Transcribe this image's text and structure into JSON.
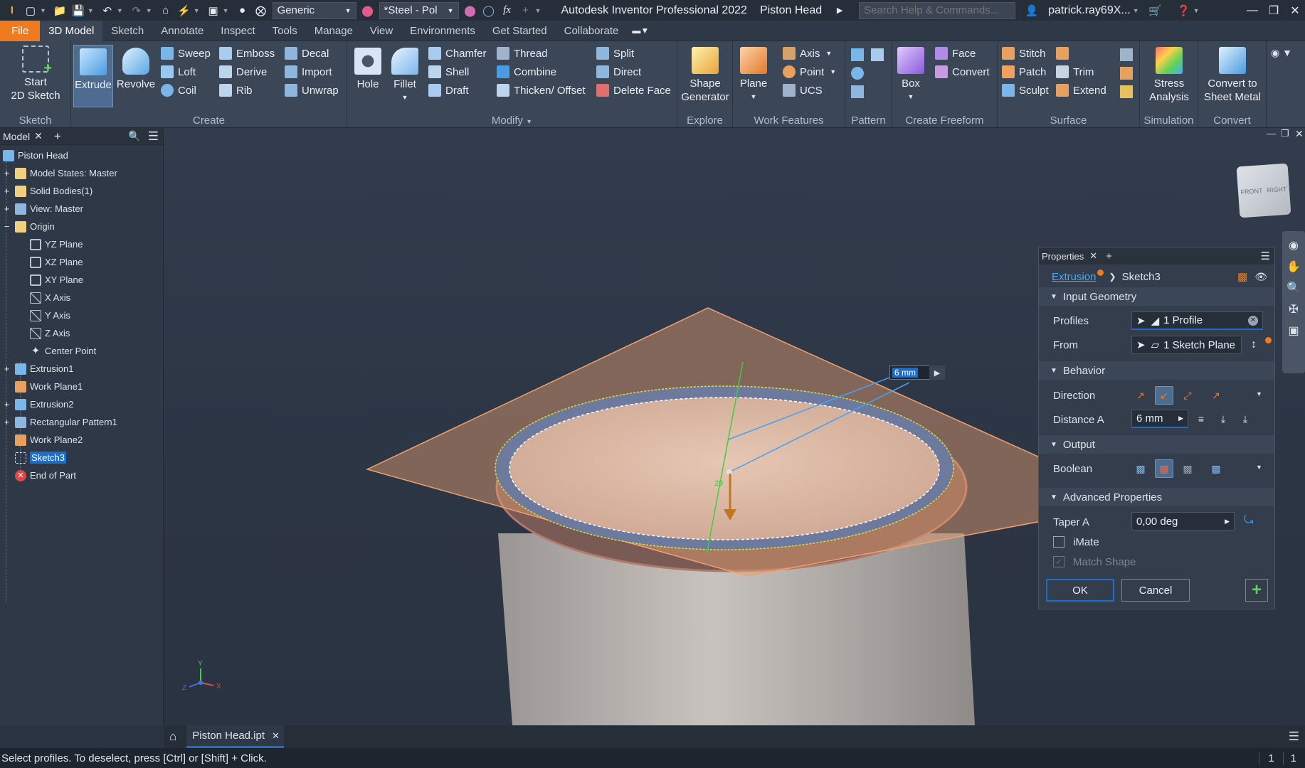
{
  "titlebar": {
    "appearance": "Generic",
    "material": "*Steel - Pol",
    "app_title": "Autodesk Inventor Professional 2022",
    "doc_name": "Piston Head",
    "search_placeholder": "Search Help & Commands...",
    "user": "patrick.ray69X..."
  },
  "menu": {
    "tabs": [
      "File",
      "3D Model",
      "Sketch",
      "Annotate",
      "Inspect",
      "Tools",
      "Manage",
      "View",
      "Environments",
      "Get Started",
      "Collaborate"
    ]
  },
  "ribbon": {
    "sketch": {
      "label": "Sketch",
      "start": "Start",
      "start2": "2D Sketch"
    },
    "create": {
      "label": "Create",
      "extrude": "Extrude",
      "revolve": "Revolve",
      "sweep": "Sweep",
      "emboss": "Emboss",
      "decal": "Decal",
      "loft": "Loft",
      "derive": "Derive",
      "import": "Import",
      "coil": "Coil",
      "rib": "Rib",
      "unwrap": "Unwrap"
    },
    "modify": {
      "label": "Modify",
      "hole": "Hole",
      "fillet": "Fillet",
      "chamfer": "Chamfer",
      "thread": "Thread",
      "split": "Split",
      "shell": "Shell",
      "combine": "Combine",
      "direct": "Direct",
      "draft": "Draft",
      "thicken": "Thicken/ Offset",
      "delete_face": "Delete Face"
    },
    "explore": {
      "label": "Explore",
      "shape": "Shape",
      "generator": "Generator"
    },
    "work": {
      "label": "Work Features",
      "plane": "Plane",
      "axis": "Axis",
      "point": "Point",
      "ucs": "UCS"
    },
    "pattern": {
      "label": "Pattern"
    },
    "freeform": {
      "label": "Create Freeform",
      "box": "Box",
      "face": "Face",
      "convert": "Convert"
    },
    "surface": {
      "label": "Surface",
      "stitch": "Stitch",
      "patch": "Patch",
      "trim": "Trim",
      "sculpt": "Sculpt",
      "extend": "Extend"
    },
    "simulation": {
      "label": "Simulation",
      "stress": "Stress",
      "analysis": "Analysis"
    },
    "convert": {
      "label": "Convert",
      "to": "Convert to",
      "sheet": "Sheet Metal"
    }
  },
  "browser": {
    "tab": "Model",
    "items": [
      {
        "label": "Piston Head"
      },
      {
        "label": "Model States: Master"
      },
      {
        "label": "Solid Bodies(1)"
      },
      {
        "label": "View: Master"
      },
      {
        "label": "Origin"
      },
      {
        "label": "YZ Plane"
      },
      {
        "label": "XZ Plane"
      },
      {
        "label": "XY Plane"
      },
      {
        "label": "X Axis"
      },
      {
        "label": "Y Axis"
      },
      {
        "label": "Z Axis"
      },
      {
        "label": "Center Point"
      },
      {
        "label": "Extrusion1"
      },
      {
        "label": "Work Plane1"
      },
      {
        "label": "Extrusion2"
      },
      {
        "label": "Rectangular Pattern1"
      },
      {
        "label": "Work Plane2"
      },
      {
        "label": "Sketch3"
      },
      {
        "label": "End of Part"
      }
    ]
  },
  "viewport": {
    "dim_value": "6 mm",
    "dim_sketch": "29",
    "viewcube_front": "FRONT",
    "viewcube_right": "RIGHT"
  },
  "properties": {
    "tab": "Properties",
    "breadcrumb_feature": "Extrusion",
    "breadcrumb_sketch": "Sketch3",
    "input_geometry": "Input Geometry",
    "profiles_label": "Profiles",
    "profiles_value": "1 Profile",
    "from_label": "From",
    "from_value": "1 Sketch Plane",
    "behavior": "Behavior",
    "direction_label": "Direction",
    "distance_label": "Distance A",
    "distance_value": "6 mm",
    "output": "Output",
    "boolean_label": "Boolean",
    "advanced": "Advanced Properties",
    "taper_label": "Taper A",
    "taper_value": "0,00 deg",
    "imate": "iMate",
    "match_shape": "Match Shape",
    "ok": "OK",
    "cancel": "Cancel"
  },
  "doc_tab": "Piston Head.ipt",
  "status": {
    "message": "Select profiles. To deselect, press [Ctrl] or [Shift] + Click.",
    "count1": "1",
    "count2": "1"
  }
}
